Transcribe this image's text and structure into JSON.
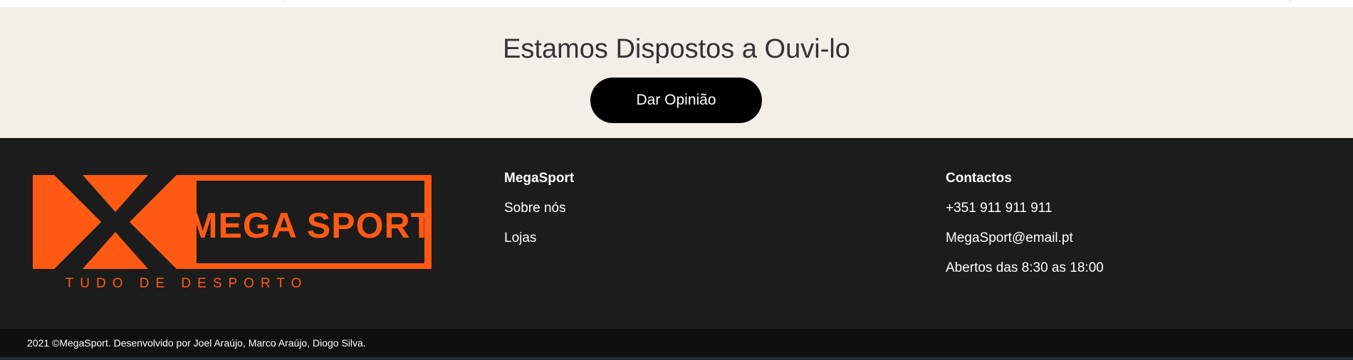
{
  "feedback": {
    "title": "Estamos Dispostos a Ouvi-lo",
    "button_label": "Dar Opinião"
  },
  "footer": {
    "logo": {
      "title": "MEGA SPORT",
      "tagline": "TUDO DE DESPORTO",
      "brand_color": "#ff5a14"
    },
    "megasport": {
      "heading": "MegaSport",
      "links": [
        "Sobre nós",
        "Lojas"
      ]
    },
    "contactos": {
      "heading": "Contactos",
      "phone": "+351 911 911 911",
      "email": "MegaSport@email.pt",
      "hours": "Abertos das 8:30 as 18:00"
    },
    "copyright": "2021 ©MegaSport. Desenvolvido por Joel Araújo, Marco Araújo, Diogo Silva."
  }
}
